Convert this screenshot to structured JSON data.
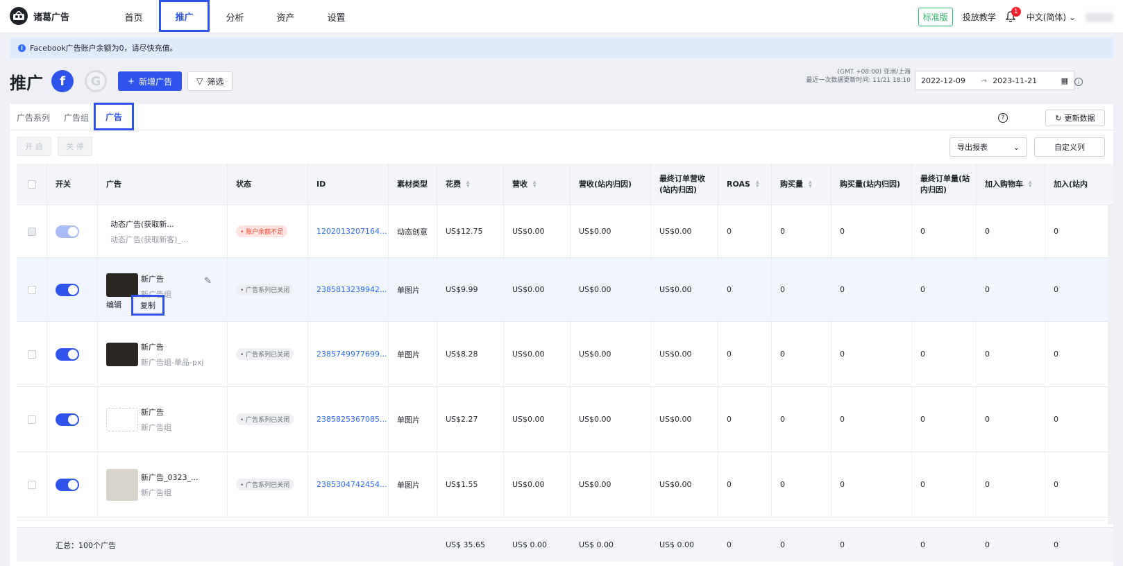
{
  "app": {
    "name": "诸葛广告"
  },
  "nav": [
    {
      "label": "首页",
      "active": false
    },
    {
      "label": "推广",
      "active": true
    },
    {
      "label": "分析",
      "active": false
    },
    {
      "label": "资产",
      "active": false
    },
    {
      "label": "设置",
      "active": false
    }
  ],
  "topRight": {
    "edition": "标准版",
    "tutorial": "投放教学",
    "notifications": "1",
    "language": "中文(简体)"
  },
  "notice": "Facebook广告账户余额为0，请尽快充值。",
  "page": {
    "title": "推广",
    "fb": "f",
    "google": "G",
    "newAd": "新增广告",
    "filter": "筛选",
    "timezone": "(GMT +08:00) 亚洲/上海",
    "lastUpdate": "最近一次数据更新时间: 11/21 18:10",
    "dateStart": "2022-12-09",
    "dateEnd": "2023-11-21"
  },
  "tabs": [
    {
      "label": "广告系列",
      "active": false
    },
    {
      "label": "广告组",
      "active": false
    },
    {
      "label": "广告",
      "active": true
    }
  ],
  "toolbar": {
    "enable": "开 启",
    "disable": "关 停",
    "refresh": "更新数据",
    "export": "导出报表",
    "customCols": "自定义列"
  },
  "columns": [
    "开关",
    "广告",
    "状态",
    "ID",
    "素材类型",
    "花费",
    "营收",
    "营收(站内归因)",
    "最终订单营收(站内归因)",
    "ROAS",
    "购买量",
    "购买量(站内归因)",
    "最终订单量(站内归因)",
    "加入购物车",
    "加入(站内"
  ],
  "rows": [
    {
      "name": "动态广告(获取新...",
      "sub": "动态广告(获取新客)_...",
      "status": "账户余额不足",
      "statusType": "red",
      "id": "1202013207164...",
      "type": "动态创意",
      "spend": "US$12.75",
      "revenue": "US$0.00",
      "revenueAttr": "US$0.00",
      "finalRevenue": "US$0.00",
      "roas": "0",
      "purchases": "0",
      "purchasesAttr": "0",
      "finalOrders": "0",
      "addCart": "0",
      "extra": "0"
    },
    {
      "name": "新广告",
      "sub": "新广告组",
      "status": "广告系列已关闭",
      "statusType": "grey",
      "id": "2385813239942...",
      "type": "单图片",
      "spend": "US$9.99",
      "revenue": "US$0.00",
      "revenueAttr": "US$0.00",
      "finalRevenue": "US$0.00",
      "roas": "0",
      "purchases": "0",
      "purchasesAttr": "0",
      "finalOrders": "0",
      "addCart": "0",
      "extra": "0",
      "edit": "编辑",
      "copy": "复制"
    },
    {
      "name": "新广告",
      "sub": "新广告组-单品-pxj",
      "status": "广告系列已关闭",
      "statusType": "grey",
      "id": "2385749977699...",
      "type": "单图片",
      "spend": "US$8.28",
      "revenue": "US$0.00",
      "revenueAttr": "US$0.00",
      "finalRevenue": "US$0.00",
      "roas": "0",
      "purchases": "0",
      "purchasesAttr": "0",
      "finalOrders": "0",
      "addCart": "0",
      "extra": "0"
    },
    {
      "name": "新广告",
      "sub": "新广告组",
      "status": "广告系列已关闭",
      "statusType": "grey",
      "id": "2385825367085...",
      "type": "单图片",
      "spend": "US$2.27",
      "revenue": "US$0.00",
      "revenueAttr": "US$0.00",
      "finalRevenue": "US$0.00",
      "roas": "0",
      "purchases": "0",
      "purchasesAttr": "0",
      "finalOrders": "0",
      "addCart": "0",
      "extra": "0"
    },
    {
      "name": "新广告_0323_...",
      "sub": "新广告组",
      "status": "广告系列已关闭",
      "statusType": "grey",
      "id": "2385304742454...",
      "type": "单图片",
      "spend": "US$1.55",
      "revenue": "US$0.00",
      "revenueAttr": "US$0.00",
      "finalRevenue": "US$0.00",
      "roas": "0",
      "purchases": "0",
      "purchasesAttr": "0",
      "finalOrders": "0",
      "addCart": "0",
      "extra": "0"
    }
  ],
  "summary": {
    "label": "汇总：100个广告",
    "spend": "US$ 35.65",
    "revenue": "US$ 0.00",
    "revenueAttr": "US$ 0.00",
    "finalRevenue": "US$ 0.00",
    "roas": "0",
    "purchases": "0",
    "purchasesAttr": "0",
    "finalOrders": "0",
    "addCart": "0",
    "extra": "0"
  }
}
